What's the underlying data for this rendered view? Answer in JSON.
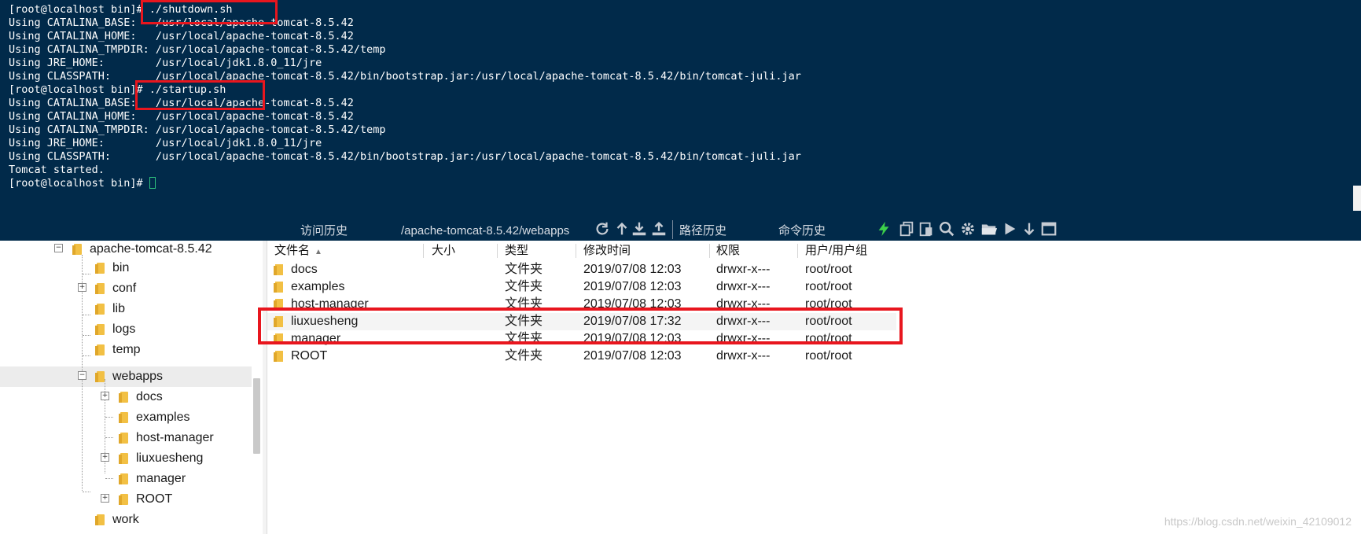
{
  "terminal": {
    "lines": [
      "[root@localhost bin]# ./shutdown.sh",
      "Using CATALINA_BASE:   /usr/local/apache-tomcat-8.5.42",
      "Using CATALINA_HOME:   /usr/local/apache-tomcat-8.5.42",
      "Using CATALINA_TMPDIR: /usr/local/apache-tomcat-8.5.42/temp",
      "Using JRE_HOME:        /usr/local/jdk1.8.0_11/jre",
      "Using CLASSPATH:       /usr/local/apache-tomcat-8.5.42/bin/bootstrap.jar:/usr/local/apache-tomcat-8.5.42/bin/tomcat-juli.jar",
      "[root@localhost bin]# ./startup.sh",
      "Using CATALINA_BASE:   /usr/local/apache-tomcat-8.5.42",
      "Using CATALINA_HOME:   /usr/local/apache-tomcat-8.5.42",
      "Using CATALINA_TMPDIR: /usr/local/apache-tomcat-8.5.42/temp",
      "Using JRE_HOME:        /usr/local/jdk1.8.0_11/jre",
      "Using CLASSPATH:       /usr/local/apache-tomcat-8.5.42/bin/bootstrap.jar:/usr/local/apache-tomcat-8.5.42/bin/tomcat-juli.jar",
      "Tomcat started.",
      "[root@localhost bin]# "
    ],
    "background": "#012a4a",
    "cursor_color": "#2ec27e",
    "highlight_color": "#e8161e"
  },
  "toolbar": {
    "history_label": "访问历史",
    "path_value": "/apache-tomcat-8.5.42/webapps",
    "path_history_label": "路径历史",
    "command_history_label": "命令历史",
    "icons": [
      "refresh-icon",
      "up-arrow-icon",
      "download-icon",
      "upload-icon",
      "lightning-icon",
      "copy-icon",
      "paste-icon",
      "search-icon",
      "gear-icon",
      "folder-open-icon",
      "play-icon",
      "down-arrow-icon",
      "window-icon"
    ]
  },
  "tree": {
    "root": "apache-tomcat-8.5.42",
    "children": [
      "bin",
      "conf",
      "lib",
      "logs",
      "temp",
      "webapps",
      "work"
    ],
    "webapps_children": [
      "docs",
      "examples",
      "host-manager",
      "liuxuesheng",
      "manager",
      "ROOT"
    ]
  },
  "files": {
    "columns": [
      "文件名",
      "大小",
      "类型",
      "修改时间",
      "权限",
      "用户/用户组"
    ],
    "rows": [
      {
        "name": "docs",
        "size": "",
        "type": "文件夹",
        "modified": "2019/07/08 12:03",
        "perm": "drwxr-x---",
        "owner": "root/root"
      },
      {
        "name": "examples",
        "size": "",
        "type": "文件夹",
        "modified": "2019/07/08 12:03",
        "perm": "drwxr-x---",
        "owner": "root/root"
      },
      {
        "name": "host-manager",
        "size": "",
        "type": "文件夹",
        "modified": "2019/07/08 12:03",
        "perm": "drwxr-x---",
        "owner": "root/root"
      },
      {
        "name": "liuxuesheng",
        "size": "",
        "type": "文件夹",
        "modified": "2019/07/08 17:32",
        "perm": "drwxr-x---",
        "owner": "root/root"
      },
      {
        "name": "manager",
        "size": "",
        "type": "文件夹",
        "modified": "2019/07/08 12:03",
        "perm": "drwxr-x---",
        "owner": "root/root"
      },
      {
        "name": "ROOT",
        "size": "",
        "type": "文件夹",
        "modified": "2019/07/08 12:03",
        "perm": "drwxr-x---",
        "owner": "root/root"
      }
    ]
  },
  "watermark": "https://blog.csdn.net/weixin_42109012"
}
